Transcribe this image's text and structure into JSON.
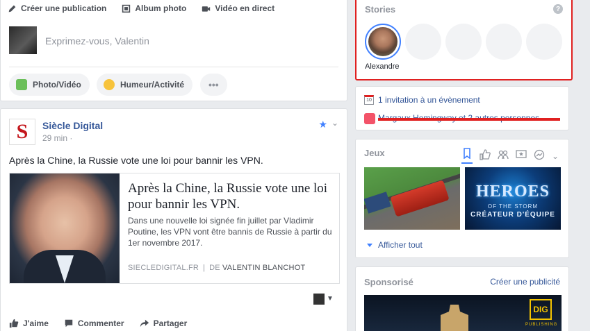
{
  "composer": {
    "tabs": [
      {
        "label": "Créer une publication",
        "icon": "pencil-icon"
      },
      {
        "label": "Album photo",
        "icon": "album-icon"
      },
      {
        "label": "Vidéo en direct",
        "icon": "video-camera-icon"
      }
    ],
    "placeholder": "Exprimez-vous, Valentin",
    "buttons": [
      {
        "label": "Photo/Vidéo",
        "icon": "photo-icon"
      },
      {
        "label": "Humeur/Activité",
        "icon": "smiley-icon"
      },
      {
        "label": "•••",
        "icon": "more-icon"
      }
    ]
  },
  "post": {
    "page_name": "Siècle Digital",
    "logo_letter": "S",
    "time": "29 min ·",
    "text": "Après la Chine, la Russie vote une loi pour bannir les VPN.",
    "link": {
      "title": "Après la Chine, la Russie vote une loi pour bannir les VPN.",
      "description": "Dans une nouvelle loi signée fin juillet par Vladimir Poutine, les VPN vont être bannis de Russie à partir du 1er novembre 2017.",
      "domain": "SIECLEDIGITAL.FR",
      "separator": "|",
      "by_label": "DE",
      "author": "VALENTIN BLANCHOT"
    },
    "actions": [
      {
        "label": "J'aime",
        "icon": "thumbs-up-icon"
      },
      {
        "label": "Commenter",
        "icon": "comment-icon"
      },
      {
        "label": "Partager",
        "icon": "share-icon"
      }
    ]
  },
  "stories": {
    "title": "Stories",
    "help": "?",
    "items": [
      {
        "name": "Alexandre"
      }
    ]
  },
  "events": {
    "calendar_day": "10",
    "invitation": "1 invitation à un évènement",
    "birthday": "Margaux Hemingway et 2 autres personnes"
  },
  "games": {
    "title": "Jeux",
    "tiles": [
      {
        "name": "train-game"
      },
      {
        "name": "heroes-of-the-storm",
        "title": "HEROES",
        "subtitle": "OF THE STORM",
        "tagline": "CRÉATEUR D'ÉQUIPE"
      }
    ],
    "show_all": "Afficher tout"
  },
  "sponsored": {
    "title": "Sponsorisé",
    "create_ad": "Créer une publicité",
    "logo_text": "DIG",
    "logo_sub": "PUBLISHING"
  },
  "colors": {
    "link_blue": "#365899",
    "accent_blue": "#4080ff",
    "highlight_red": "#e02020",
    "background": "#e9ebee"
  }
}
